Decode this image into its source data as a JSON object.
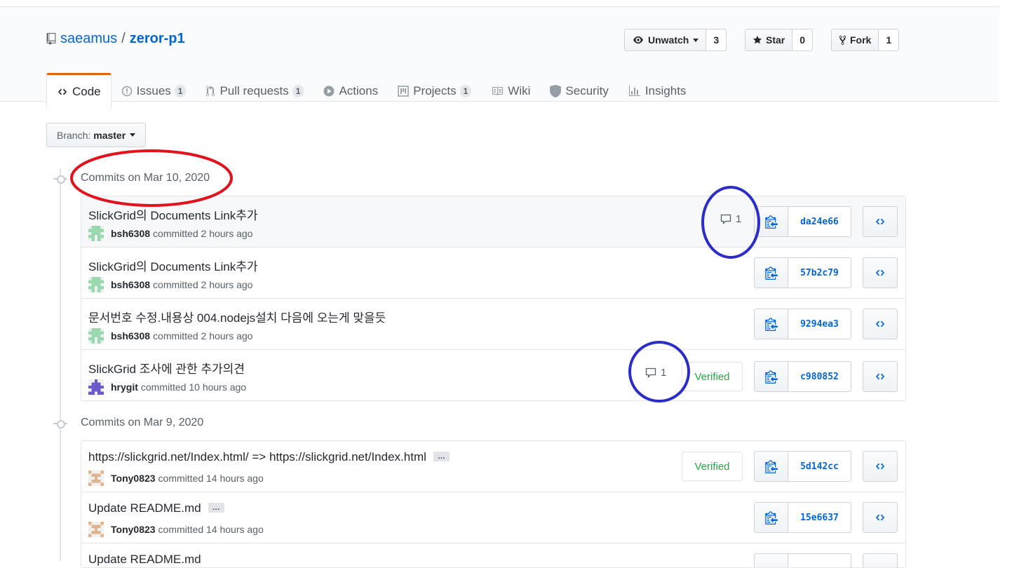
{
  "repo": {
    "owner": "saeamus",
    "separator": "/",
    "name": "zeror-p1"
  },
  "actions": {
    "watch": {
      "label": "Unwatch",
      "count": "3"
    },
    "star": {
      "label": "Star",
      "count": "0"
    },
    "fork": {
      "label": "Fork",
      "count": "1"
    }
  },
  "tabs": [
    {
      "label": "Code",
      "icon": "code-icon"
    },
    {
      "label": "Issues",
      "counter": "1",
      "icon": "issue-icon"
    },
    {
      "label": "Pull requests",
      "counter": "1",
      "icon": "pull-request-icon"
    },
    {
      "label": "Actions",
      "icon": "play-icon"
    },
    {
      "label": "Projects",
      "counter": "1",
      "icon": "project-icon"
    },
    {
      "label": "Wiki",
      "icon": "book-icon"
    },
    {
      "label": "Security",
      "icon": "shield-icon"
    },
    {
      "label": "Insights",
      "icon": "graph-icon"
    }
  ],
  "branch": {
    "label": "Branch:",
    "value": "master"
  },
  "groups": [
    {
      "title": "Commits on Mar 10, 2020",
      "commits": [
        {
          "message": "SlickGrid의 Documents Link추가",
          "author": "bsh6308",
          "verb": "committed",
          "time": "2 hours ago",
          "comments": "1",
          "sha": "da24e66"
        },
        {
          "message": "SlickGrid의 Documents Link추가",
          "author": "bsh6308",
          "verb": "committed",
          "time": "2 hours ago",
          "sha": "57b2c79"
        },
        {
          "message": "문서번호 수정.내용상 004.nodejs설치 다음에 오는게 맞을듯",
          "author": "bsh6308",
          "verb": "committed",
          "time": "2 hours ago",
          "sha": "9294ea3"
        },
        {
          "message": "SlickGrid 조사에 관한 추가의견",
          "author": "hrygit",
          "verb": "committed",
          "time": "10 hours ago",
          "comments": "1",
          "verified": "Verified",
          "sha": "c980852"
        }
      ]
    },
    {
      "title": "Commits on Mar 9, 2020",
      "commits": [
        {
          "message": "https://slickgrid.net/Index.html/ => https://slickgrid.net/Index.html",
          "ellipsis": "…",
          "author": "Tony0823",
          "verb": "committed",
          "time": "14 hours ago",
          "verified": "Verified",
          "sha": "5d142cc"
        },
        {
          "message": "Update README.md",
          "ellipsis": "…",
          "author": "Tony0823",
          "verb": "committed",
          "time": "14 hours ago",
          "sha": "15e6637"
        },
        {
          "message": "Update README.md",
          "author": "",
          "verb": "",
          "time": "",
          "sha": ""
        }
      ]
    }
  ],
  "colors": {
    "link": "#0366d6",
    "tab_accent": "#e36209",
    "verified": "#28a745",
    "annotation_red": "#e0141e",
    "annotation_blue": "#2c2cc8"
  }
}
